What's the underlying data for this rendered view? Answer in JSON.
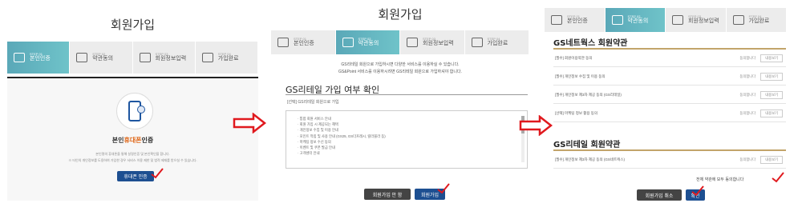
{
  "panel1": {
    "title": "회원가입",
    "steps": [
      {
        "num": "STEP 01",
        "label": "본인인증",
        "active": true
      },
      {
        "num": "STEP 02",
        "label": "약관동의",
        "active": false
      },
      {
        "num": "STEP 03",
        "label": "회원정보입력",
        "active": false
      },
      {
        "num": "STEP 04",
        "label": "가입완료",
        "active": false
      }
    ],
    "auth_title_hl": "휴대폰",
    "auth_title_pre": "본인",
    "auth_title_post": "인증",
    "desc_line1": "본인명의 휴대폰을 통해 실명인증 및 본인확인을 합니다.",
    "desc_line2": "※ 타인의 개인정보를 도용하여 가입한 경우 서비스 이용 제한 및 법적 제재를 받으실 수 있습니다.",
    "button": "휴대폰 인증"
  },
  "panel2": {
    "title": "회원가입",
    "steps": [
      {
        "num": "STEP 01",
        "label": "본인인증",
        "active": false
      },
      {
        "num": "STEP 02",
        "label": "약관동의",
        "active": true
      },
      {
        "num": "STEP 03",
        "label": "회원정보입력",
        "active": false
      },
      {
        "num": "STEP 04",
        "label": "가입완료",
        "active": false
      }
    ],
    "intro_line1": "GS리테일 회원으로 가입하시면 다양한 서비스를 이용하실 수 있습니다.",
    "intro_line2": "GS&Point 서비스를 이용하시려면 GS리테일 회원으로 가입하셔야 합니다.",
    "section_title": "GS리테일 가입 여부 확인",
    "sub": "[선택] GS리테일 회원으로 가입",
    "box_items": [
      "· 통합 회원 서비스 안내",
      "· 회원 가입 시 제공되는 혜택",
      "· 개인정보 수집 및 이용 안내",
      "· 포인트 적립 및 사용 안내 (GS25, GS더프레시, 랄라블라 등)",
      "· 마케팅 정보 수신 동의",
      "· 이벤트 및 쿠폰 발급 안내",
      "· 고객센터 안내"
    ],
    "btn_cancel": "회원가입 안 함",
    "btn_ok": "회원가입"
  },
  "panel3": {
    "steps": [
      {
        "num": "STEP 01",
        "label": "본인인증",
        "active": false
      },
      {
        "num": "STEP 02",
        "label": "약관동의",
        "active": true
      },
      {
        "num": "STEP 03",
        "label": "회원정보입력",
        "active": false
      },
      {
        "num": "STEP 04",
        "label": "가입완료",
        "active": false
      }
    ],
    "section1_title": "GS네트웍스 회원약관",
    "terms1": [
      {
        "name": "[필수] 회원이용약관 동의",
        "agree": "동의합니다",
        "view": "내용보기"
      },
      {
        "name": "[필수] 개인정보 수집 및 이용 동의",
        "agree": "동의합니다",
        "view": "내용보기"
      },
      {
        "name": "[필수] 개인정보 제3자 제공 동의 (GS리테일)",
        "agree": "동의합니다",
        "view": "내용보기"
      },
      {
        "name": "[선택] 마케팅 정보 활용 동의",
        "agree": "동의합니다",
        "view": "내용보기"
      }
    ],
    "section2_title": "GS리테일 회원약관",
    "terms2": [
      {
        "name": "[필수] 개인정보 제3자 제공 동의 (GS네트웍스)",
        "agree": "동의합니다",
        "view": "내용보기"
      }
    ],
    "agree_all": "전체 약관에 모두 동의합니다",
    "btn_cancel": "회원가입 취소",
    "btn_ok": "확인"
  },
  "colors": {
    "accent": "#1d4f91",
    "step_active": "#5aa8b8",
    "arrow": "#e0191e",
    "check": "#e0191e",
    "gold": "#c2a46a"
  }
}
